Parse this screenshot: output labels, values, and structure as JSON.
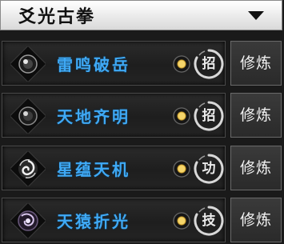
{
  "header": {
    "title": "爻光古拳",
    "dropdown_icon": "chevron-down-icon"
  },
  "skills": [
    {
      "name": "雷鸣破岳",
      "type_label": "招",
      "action_label": "修炼",
      "icon": "dark-orb-icon",
      "coin_icon": "gold-coin-icon"
    },
    {
      "name": "天地齐明",
      "type_label": "招",
      "action_label": "修炼",
      "icon": "dark-orb-icon",
      "coin_icon": "gold-coin-icon"
    },
    {
      "name": "星蕴天机",
      "type_label": "功",
      "action_label": "修炼",
      "icon": "white-swirl-icon",
      "coin_icon": "gold-coin-icon"
    },
    {
      "name": "天猿折光",
      "type_label": "技",
      "action_label": "修炼",
      "icon": "purple-vortex-icon",
      "coin_icon": "gold-coin-icon"
    }
  ],
  "colors": {
    "skill_name": "#3fa9f5",
    "header_bg": "#f0f0f0",
    "panel_bg": "#1a1a1a"
  }
}
